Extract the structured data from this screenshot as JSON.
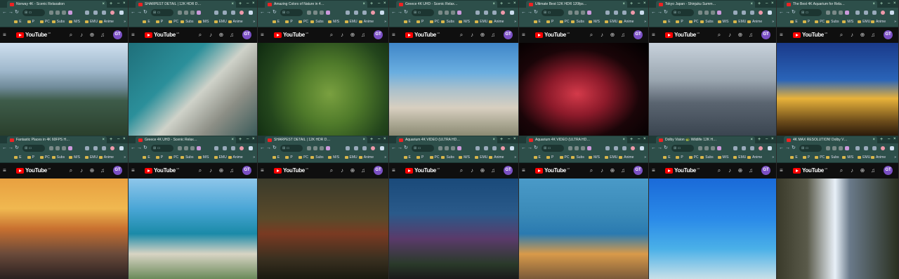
{
  "bookmarks": [
    "E",
    "P",
    "PC",
    "Subs",
    "M/S",
    "EMU",
    "Anime"
  ],
  "youtube": {
    "logo_text": "YouTube",
    "country_code": "GB",
    "avatar": "GT"
  },
  "windows": [
    {
      "tab_title": "Norway 4K - Scenic Relaxation",
      "theme": "g1"
    },
    {
      "tab_title": "SHARPEST DETAIL | 12K HDR D…",
      "theme": "g2"
    },
    {
      "tab_title": "Amazing Colors of Nature in 4…",
      "theme": "g3"
    },
    {
      "tab_title": "Greece 4K UHD - Scenic Relax…",
      "theme": "g4"
    },
    {
      "tab_title": "Ultimate Best 12K HDR 120fps…",
      "theme": "g5"
    },
    {
      "tab_title": "Tokyo Japan - Shinjuku Summ…",
      "theme": "g6"
    },
    {
      "tab_title": "The Best 4K Aquarium for Rela…",
      "theme": "g7"
    },
    {
      "tab_title": "Fantastic Places in 4K 60FPS H…",
      "theme": "g8"
    },
    {
      "tab_title": "Greece 4K UHD - Scenic Relax…",
      "theme": "g9"
    },
    {
      "tab_title": "SHARPEST DETAIL | 12K HDR D…",
      "theme": "g10"
    },
    {
      "tab_title": "Aquarium 4K VIDEO (ULTRA HD…",
      "theme": "g11"
    },
    {
      "tab_title": "Aquarium 4K VIDEO (ULTRA HD…",
      "theme": "g12"
    },
    {
      "tab_title": "Dolby Vision 🐢 Wildlife 12K H…",
      "theme": "g13"
    },
    {
      "tab_title": "4K MAX RESOLUTION! Dolby V…",
      "theme": "g14"
    }
  ]
}
